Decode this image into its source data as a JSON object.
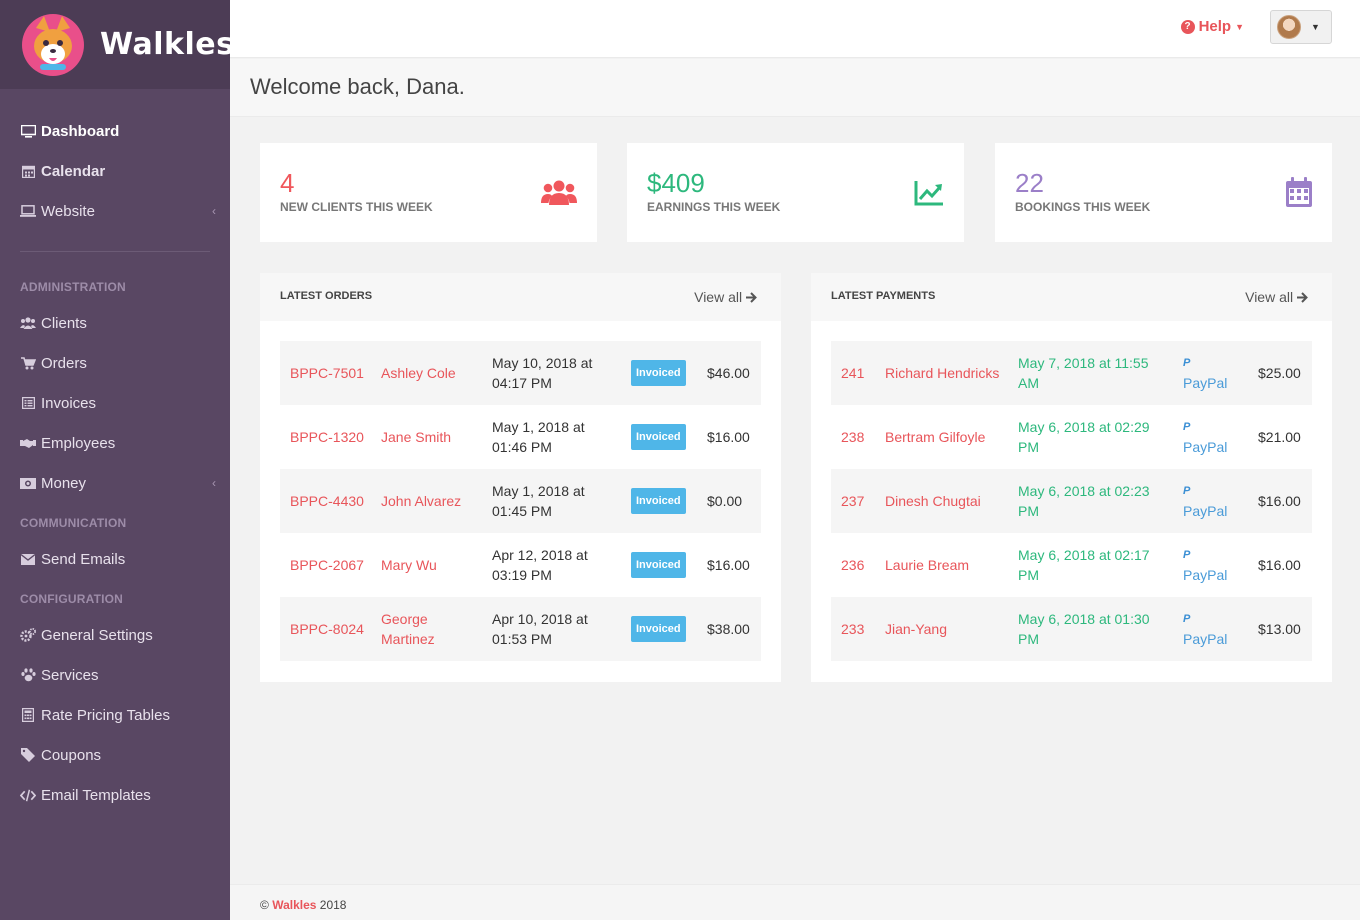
{
  "brand": {
    "name": "Walkles"
  },
  "sidebar": {
    "items_top": [
      {
        "label": "Dashboard",
        "icon": "monitor-icon",
        "active": true
      },
      {
        "label": "Calendar",
        "icon": "calendar-icon"
      },
      {
        "label": "Website",
        "icon": "laptop-icon",
        "has_chevron": true
      }
    ],
    "sections": [
      {
        "title": "ADMINISTRATION",
        "items": [
          {
            "label": "Clients",
            "icon": "users-icon"
          },
          {
            "label": "Orders",
            "icon": "cart-icon"
          },
          {
            "label": "Invoices",
            "icon": "list-icon"
          },
          {
            "label": "Employees",
            "icon": "handshake-icon"
          },
          {
            "label": "Money",
            "icon": "money-icon",
            "has_chevron": true
          }
        ]
      },
      {
        "title": "COMMUNICATION",
        "items": [
          {
            "label": "Send Emails",
            "icon": "envelope-icon"
          }
        ]
      },
      {
        "title": "CONFIGURATION",
        "items": [
          {
            "label": "General Settings",
            "icon": "gears-icon"
          },
          {
            "label": "Services",
            "icon": "paw-icon"
          },
          {
            "label": "Rate Pricing Tables",
            "icon": "calculator-icon"
          },
          {
            "label": "Coupons",
            "icon": "tag-icon"
          },
          {
            "label": "Email Templates",
            "icon": "code-icon"
          }
        ]
      }
    ]
  },
  "topbar": {
    "help_label": "Help"
  },
  "welcome": {
    "text": "Welcome back, Dana."
  },
  "stats": [
    {
      "value": "4",
      "label": "NEW CLIENTS THIS WEEK",
      "color": "#f0575c",
      "icon": "users-icon"
    },
    {
      "value": "$409",
      "label": "EARNINGS THIS WEEK",
      "color": "#2db87d",
      "icon": "line-chart-icon"
    },
    {
      "value": "22",
      "label": "BOOKINGS THIS WEEK",
      "color": "#9b7fc8",
      "icon": "calendar-icon"
    }
  ],
  "orders": {
    "title": "LATEST ORDERS",
    "view_all": "View all",
    "rows": [
      {
        "id": "BPPC-7501",
        "name": "Ashley Cole",
        "date": "May 10, 2018 at 04:17 PM",
        "status": "Invoiced",
        "amount": "$46.00"
      },
      {
        "id": "BPPC-1320",
        "name": "Jane Smith",
        "date": "May 1, 2018 at 01:46 PM",
        "status": "Invoiced",
        "amount": "$16.00"
      },
      {
        "id": "BPPC-4430",
        "name": "John Alvarez",
        "date": "May 1, 2018 at 01:45 PM",
        "status": "Invoiced",
        "amount": "$0.00"
      },
      {
        "id": "BPPC-2067",
        "name": "Mary Wu",
        "date": "Apr 12, 2018 at 03:19 PM",
        "status": "Invoiced",
        "amount": "$16.00"
      },
      {
        "id": "BPPC-8024",
        "name": "George Martinez",
        "date": "Apr 10, 2018 at 01:53 PM",
        "status": "Invoiced",
        "amount": "$38.00"
      }
    ]
  },
  "payments": {
    "title": "LATEST PAYMENTS",
    "view_all": "View all",
    "rows": [
      {
        "id": "241",
        "name": "Richard Hendricks",
        "date": "May 7, 2018 at 11:55 AM",
        "method": "PayPal",
        "amount": "$25.00"
      },
      {
        "id": "238",
        "name": "Bertram Gilfoyle",
        "date": "May 6, 2018 at 02:29 PM",
        "method": "PayPal",
        "amount": "$21.00"
      },
      {
        "id": "237",
        "name": "Dinesh Chugtai",
        "date": "May 6, 2018 at 02:23 PM",
        "method": "PayPal",
        "amount": "$16.00"
      },
      {
        "id": "236",
        "name": "Laurie Bream",
        "date": "May 6, 2018 at 02:17 PM",
        "method": "PayPal",
        "amount": "$16.00"
      },
      {
        "id": "233",
        "name": "Jian-Yang",
        "date": "May 6, 2018 at 01:30 PM",
        "method": "PayPal",
        "amount": "$13.00"
      }
    ]
  },
  "footer": {
    "copyright": "©",
    "brand": "Walkles",
    "year": "2018"
  }
}
